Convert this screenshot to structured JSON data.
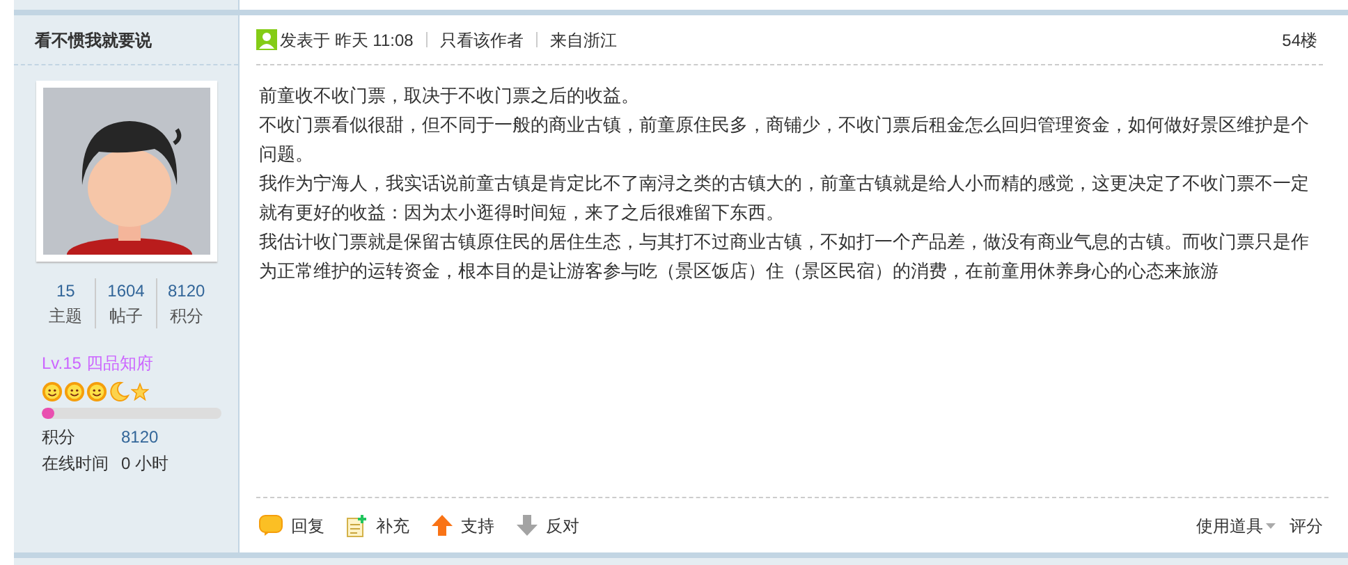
{
  "author": {
    "name": "看不惯我就要说",
    "stats": [
      {
        "value": "15",
        "label": "主题"
      },
      {
        "value": "1604",
        "label": "帖子"
      },
      {
        "value": "8120",
        "label": "积分"
      }
    ],
    "rank": "Lv.15 四品知府",
    "rank_icons": [
      {
        "kind": "sun"
      },
      {
        "kind": "sun"
      },
      {
        "kind": "sun"
      },
      {
        "kind": "moon"
      },
      {
        "kind": "star"
      }
    ],
    "progress": {
      "level": 0.07
    },
    "details": [
      {
        "label": "积分",
        "value": "8120"
      },
      {
        "label": "在线时间",
        "value": "0 小时"
      }
    ]
  },
  "post": {
    "meta": [
      "发表于 昨天 11:08",
      "只看该作者",
      "来自浙江"
    ],
    "floor": "54楼",
    "paragraphs": [
      "前童收不收门票，取决于不收门票之后的收益。",
      "不收门票看似很甜，但不同于一般的商业古镇，前童原住民多，商铺少，不收门票后租金怎么回归管理资金，如何做好景区维护是个问题。",
      "我作为宁海人，我实话说前童古镇是肯定比不了南浔之类的古镇大的，前童古镇就是给人小而精的感觉，这更决定了不收门票不一定就有更好的收益：因为太小逛得时间短，来了之后很难留下东西。",
      "我估计收门票就是保留古镇原住民的居住生态，与其打不过商业古镇，不如打一个产品差，做没有商业气息的古镇。而收门票只是作为正常维护的运转资金，根本目的是让游客参与吃（景区饭店）住（景区民宿）的消费，在前童用休养身心的心态来旅游"
    ],
    "actions": [
      {
        "label": "回复",
        "kind": "reply"
      },
      {
        "label": "补充",
        "kind": "add"
      },
      {
        "label": "支持",
        "kind": "up"
      },
      {
        "label": "反对",
        "kind": "down"
      }
    ],
    "tools": [
      {
        "label": "使用道具",
        "kind": "dropdown"
      },
      {
        "label": "评分",
        "kind": "plain"
      }
    ]
  }
}
